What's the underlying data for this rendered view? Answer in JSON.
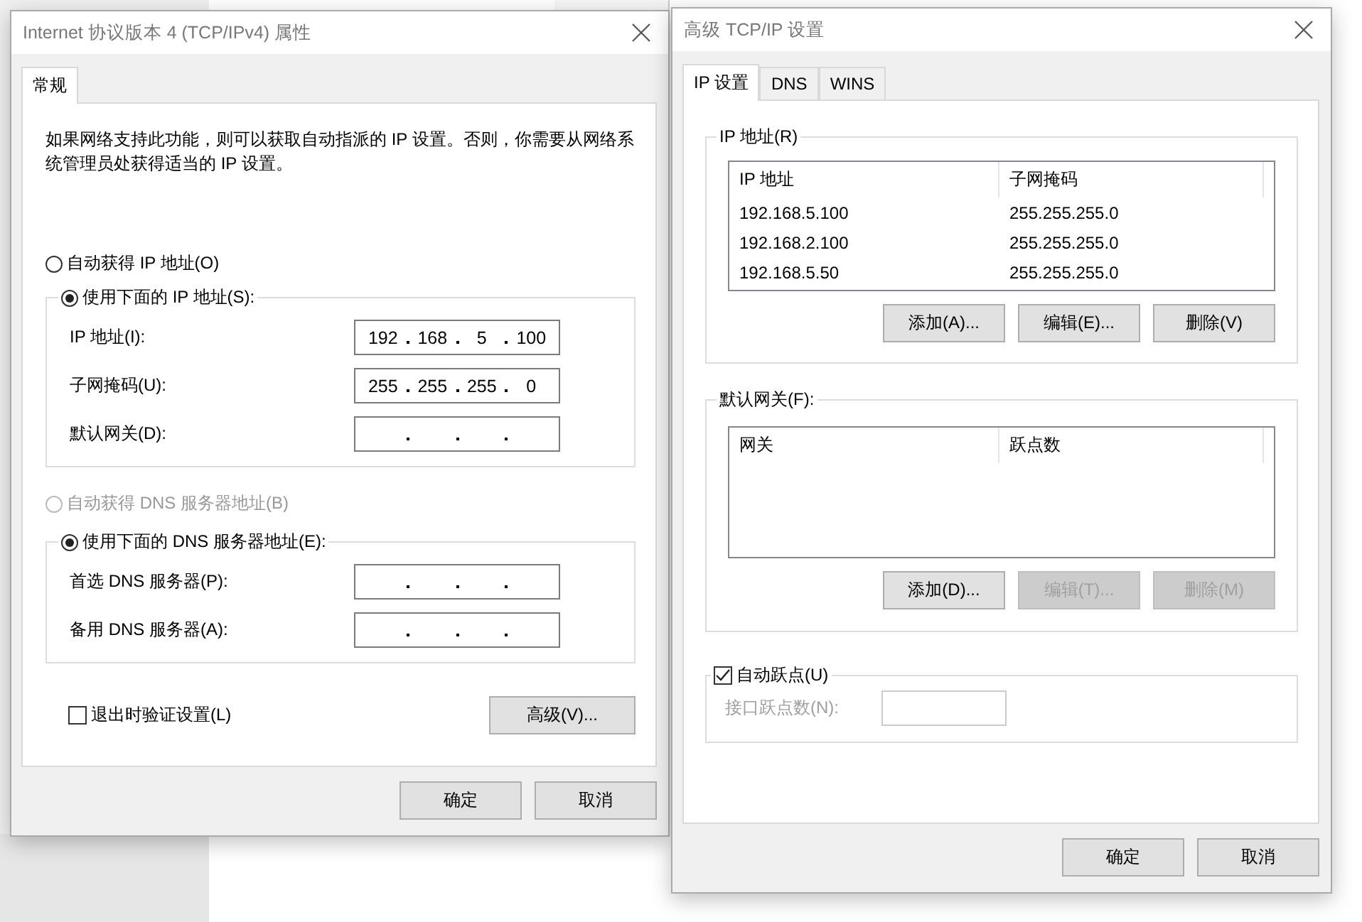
{
  "ipv4_dialog": {
    "title": "Internet 协议版本 4 (TCP/IPv4) 属性",
    "tabs": [
      {
        "label": "常规",
        "selected": true
      }
    ],
    "description": "如果网络支持此功能，则可以获取自动指派的 IP 设置。否则，你需要从网络系统管理员处获得适当的 IP 设置。",
    "ip_mode": [
      {
        "label": "自动获得 IP 地址(O)",
        "selected": false,
        "disabled": false
      },
      {
        "label": "使用下面的 IP 地址(S):",
        "selected": true,
        "disabled": false
      }
    ],
    "ip_fields": [
      {
        "label": "IP 地址(I):",
        "octets": [
          "192",
          "168",
          "5",
          "100"
        ]
      },
      {
        "label": "子网掩码(U):",
        "octets": [
          "255",
          "255",
          "255",
          "0"
        ]
      },
      {
        "label": "默认网关(D):"
      }
    ],
    "dns_mode": [
      {
        "label": "自动获得 DNS 服务器地址(B)",
        "selected": false,
        "disabled": true
      },
      {
        "label": "使用下面的 DNS 服务器地址(E):",
        "selected": true,
        "disabled": false
      }
    ],
    "dns_fields": [
      {
        "label": "首选 DNS 服务器(P):"
      },
      {
        "label": "备用 DNS 服务器(A):"
      }
    ],
    "validate_on_exit": {
      "label": "退出时验证设置(L)",
      "checked": false
    },
    "advanced_button": "高级(V)...",
    "buttons": [
      "确定",
      "取消"
    ]
  },
  "advanced_dialog": {
    "title": "高级 TCP/IP 设置",
    "tabs": [
      {
        "label": "IP 设置",
        "selected": true
      },
      {
        "label": "DNS",
        "selected": false
      },
      {
        "label": "WINS",
        "selected": false
      }
    ],
    "ip_group": {
      "title": "IP 地址(R)",
      "columns": [
        "IP 地址",
        "子网掩码"
      ],
      "rows": [
        [
          "192.168.5.100",
          "255.255.255.0"
        ],
        [
          "192.168.2.100",
          "255.255.255.0"
        ],
        [
          "192.168.5.50",
          "255.255.255.0"
        ]
      ],
      "buttons": [
        {
          "label": "添加(A)...",
          "disabled": false
        },
        {
          "label": "编辑(E)...",
          "disabled": false
        },
        {
          "label": "删除(V)",
          "disabled": false
        }
      ]
    },
    "gateway_group": {
      "title": "默认网关(F):",
      "columns": [
        "网关",
        "跃点数"
      ],
      "buttons": [
        {
          "label": "添加(D)...",
          "disabled": false
        },
        {
          "label": "编辑(T)...",
          "disabled": true
        },
        {
          "label": "删除(M)",
          "disabled": true
        }
      ]
    },
    "auto_metric": {
      "label": "自动跃点(U)",
      "checked": true
    },
    "metric_field": {
      "label": "接口跃点数(N):",
      "disabled": true
    },
    "buttons": [
      "确定",
      "取消"
    ]
  }
}
